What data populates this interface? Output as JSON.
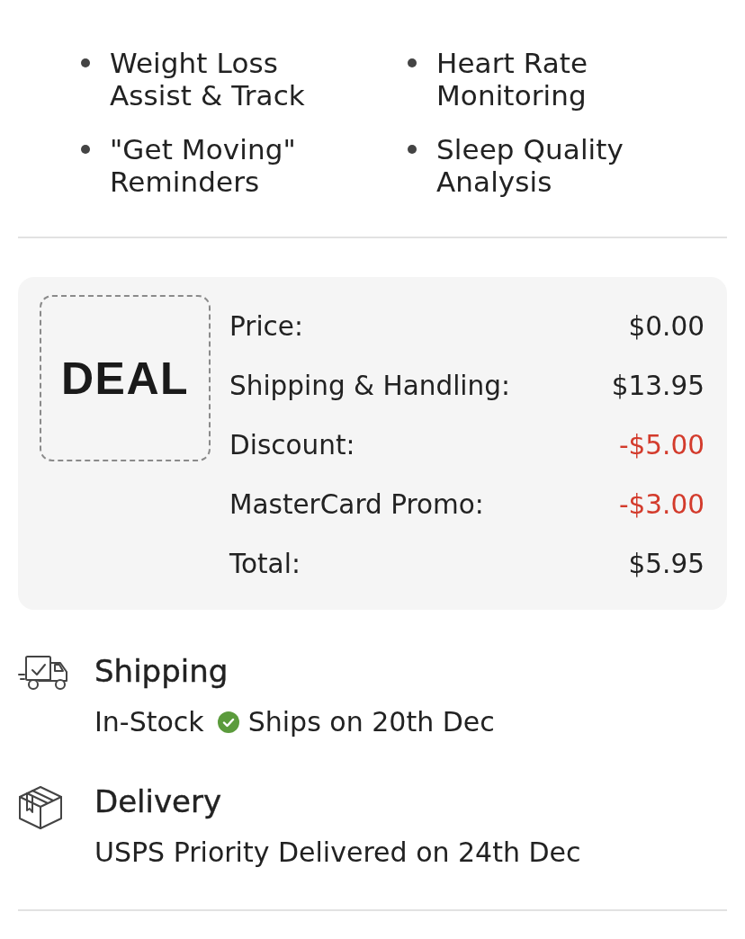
{
  "features": [
    "Weight Loss Assist & Track",
    "Heart Rate Monitoring",
    "\"Get Moving\" Reminders",
    "Sleep Quality Analysis"
  ],
  "deal": {
    "badge": "DEAL",
    "rows": [
      {
        "label": "Price:",
        "value": "$0.00",
        "kind": "charge"
      },
      {
        "label": "Shipping & Handling:",
        "value": "$13.95",
        "kind": "charge"
      },
      {
        "label": "Discount:",
        "value": "-$5.00",
        "kind": "deduction"
      },
      {
        "label": "MasterCard Promo:",
        "value": "-$3.00",
        "kind": "deduction"
      },
      {
        "label": "Total:",
        "value": "$5.95",
        "kind": "charge"
      }
    ]
  },
  "fulfillment": [
    {
      "kind": "shipping",
      "title": "Shipping",
      "status": "In-Stock",
      "detail": "Ships on 20th Dec"
    },
    {
      "kind": "delivery",
      "title": "Delivery",
      "detail": "USPS Priority Delivered on 24th Dec"
    }
  ]
}
